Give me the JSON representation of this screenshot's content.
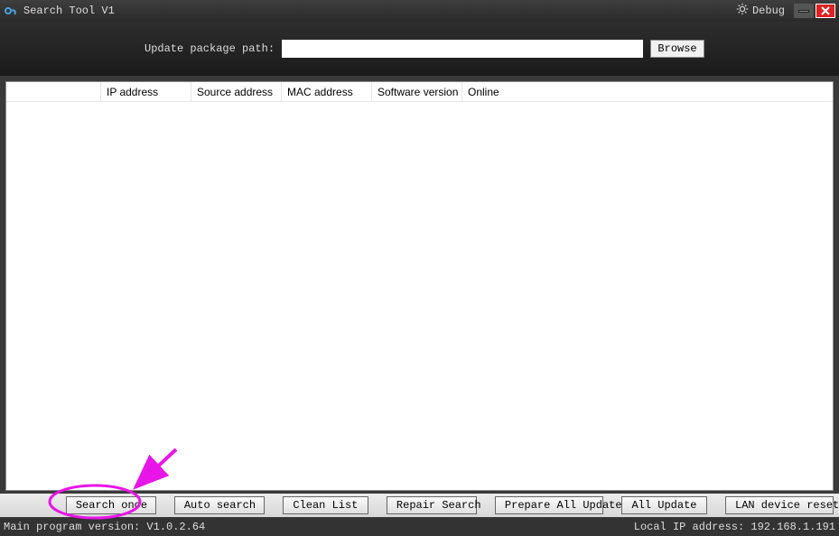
{
  "window": {
    "title": "Search Tool V1",
    "debug_label": "Debug"
  },
  "toolbar": {
    "path_label": "Update package path:",
    "path_value": "",
    "browse_label": "Browse"
  },
  "columns": {
    "c0": "",
    "c1": "IP address",
    "c2": "Source address",
    "c3": "MAC address",
    "c4": "Software version",
    "c5": "Online"
  },
  "buttons": {
    "search_once": "Search once",
    "auto_search": "Auto search",
    "clean_list": "Clean List",
    "repair_search": "Repair Search",
    "prepare_all_update": "Prepare All Update",
    "all_update": "All Update",
    "lan_device_reset": "LAN device reset"
  },
  "status": {
    "program_version": "Main program version: V1.0.2.64",
    "local_ip": "Local IP address: 192.168.1.191"
  }
}
